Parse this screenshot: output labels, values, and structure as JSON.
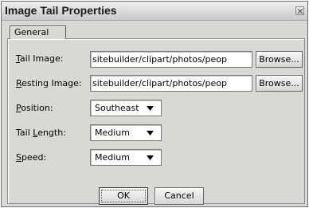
{
  "dialog": {
    "title": "Image Tail Properties",
    "close_icon": "close-x-icon"
  },
  "tabs": [
    {
      "label": "General",
      "selected": true
    }
  ],
  "form": {
    "tail_image": {
      "label_underline": "T",
      "label_rest": "ail Image:",
      "value": "sitebuilder/clipart/photos/peop",
      "browse_label": "Browse..."
    },
    "resting_image": {
      "label_underline": "R",
      "label_rest": "esting Image:",
      "value": "sitebuilder/clipart/photos/peop",
      "browse_label": "Browse..."
    },
    "position": {
      "label_underline": "P",
      "label_rest": "osition:",
      "value": "Southeast"
    },
    "tail_length": {
      "label_before": "Tail ",
      "label_underline": "L",
      "label_rest": "ength:",
      "value": "Medium"
    },
    "speed": {
      "label_underline": "S",
      "label_rest": "peed:",
      "value": "Medium"
    }
  },
  "buttons": {
    "ok_label": "OK",
    "cancel_label": "Cancel"
  },
  "icons": {
    "dropdown": "caret-down-icon"
  }
}
